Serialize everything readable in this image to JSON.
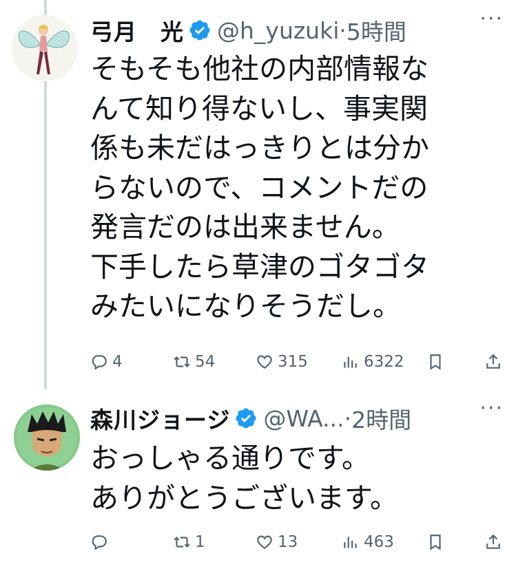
{
  "tweets": [
    {
      "name": "弓月　光",
      "handle": "@h_yuzuki",
      "separator": "·",
      "time": "5時間",
      "more": "···",
      "text": "そもそも他社の内部情報な\nんて知り得ないし、事実関\n係も未だはっきりとは分か\nらないので、コメントだの\n発言だのは出来ません。\n下手したら草津のゴタゴタ\nみたいになりそうだし。",
      "replies": "4",
      "retweets": "54",
      "likes": "315",
      "views": "6322"
    },
    {
      "name": "森川ジョージ",
      "handle": "@WA...",
      "separator": "·",
      "time": "2時間",
      "more": "···",
      "text": "おっしゃる通りです。\nありがとうございます。",
      "replies": "",
      "retweets": "1",
      "likes": "13",
      "views": "463"
    }
  ],
  "colors": {
    "verified": "#1d9bf0",
    "secondary_text": "#536471",
    "primary_text": "#0f1419",
    "thread_line": "#cfd9de"
  },
  "icons": [
    "reply-icon",
    "retweet-icon",
    "like-icon",
    "views-icon",
    "bookmark-icon",
    "share-icon",
    "verified-badge-icon",
    "more-icon"
  ]
}
